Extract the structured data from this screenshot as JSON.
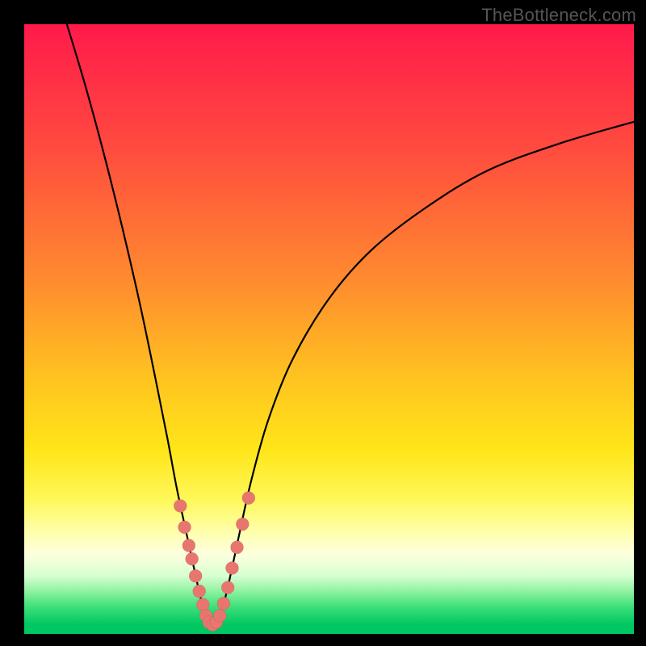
{
  "watermark": "TheBottleneck.com",
  "colors": {
    "frame": "#000000",
    "curve": "#000000",
    "dot": "#e8766f",
    "gradient_stops": [
      {
        "offset": 0.0,
        "color": "#ff1a4b"
      },
      {
        "offset": 0.2,
        "color": "#ff4a3f"
      },
      {
        "offset": 0.42,
        "color": "#ff8b2f"
      },
      {
        "offset": 0.58,
        "color": "#ffc320"
      },
      {
        "offset": 0.7,
        "color": "#ffe61a"
      },
      {
        "offset": 0.78,
        "color": "#fff85a"
      },
      {
        "offset": 0.835,
        "color": "#ffffb0"
      },
      {
        "offset": 0.87,
        "color": "#fdffde"
      },
      {
        "offset": 0.905,
        "color": "#d6ffd0"
      },
      {
        "offset": 0.93,
        "color": "#8ff2a0"
      },
      {
        "offset": 0.955,
        "color": "#3fe07a"
      },
      {
        "offset": 0.985,
        "color": "#00c762"
      },
      {
        "offset": 1.0,
        "color": "#00c762"
      }
    ]
  },
  "chart_data": {
    "type": "line",
    "title": "",
    "xlabel": "",
    "ylabel": "",
    "xlim": [
      0,
      100
    ],
    "ylim": [
      0,
      100
    ],
    "series": [
      {
        "name": "bottleneck-curve",
        "x": [
          7,
          10,
          13,
          16,
          19,
          21.5,
          23.5,
          25,
          26.5,
          27.8,
          28.8,
          29.6,
          30.3,
          31,
          31.7,
          32.6,
          33.7,
          35.2,
          37.2,
          40,
          44,
          50,
          57,
          66,
          76,
          88,
          100
        ],
        "y": [
          100,
          90,
          79,
          67,
          54,
          42,
          32,
          24,
          17,
          11,
          6.5,
          3.5,
          1.8,
          1.5,
          2.2,
          4.5,
          9,
          16,
          25,
          35,
          45,
          55,
          63,
          70,
          76,
          80.5,
          84
        ]
      }
    ],
    "scatter": {
      "name": "highlight-dots",
      "points": [
        {
          "x": 25.6,
          "y": 21.0,
          "r": 8
        },
        {
          "x": 26.3,
          "y": 17.5,
          "r": 8
        },
        {
          "x": 27.0,
          "y": 14.5,
          "r": 8
        },
        {
          "x": 27.5,
          "y": 12.3,
          "r": 8
        },
        {
          "x": 28.1,
          "y": 9.5,
          "r": 8
        },
        {
          "x": 28.7,
          "y": 7.0,
          "r": 8
        },
        {
          "x": 29.3,
          "y": 4.8,
          "r": 8
        },
        {
          "x": 29.8,
          "y": 3.0,
          "r": 8
        },
        {
          "x": 30.3,
          "y": 1.9,
          "r": 8
        },
        {
          "x": 30.9,
          "y": 1.5,
          "r": 8
        },
        {
          "x": 31.5,
          "y": 1.9,
          "r": 8
        },
        {
          "x": 32.1,
          "y": 3.0,
          "r": 8
        },
        {
          "x": 32.7,
          "y": 5.0,
          "r": 8
        },
        {
          "x": 33.4,
          "y": 7.6,
          "r": 8
        },
        {
          "x": 34.1,
          "y": 10.8,
          "r": 8
        },
        {
          "x": 34.9,
          "y": 14.2,
          "r": 8
        },
        {
          "x": 35.8,
          "y": 18.0,
          "r": 8
        },
        {
          "x": 36.8,
          "y": 22.3,
          "r": 8
        }
      ]
    }
  }
}
